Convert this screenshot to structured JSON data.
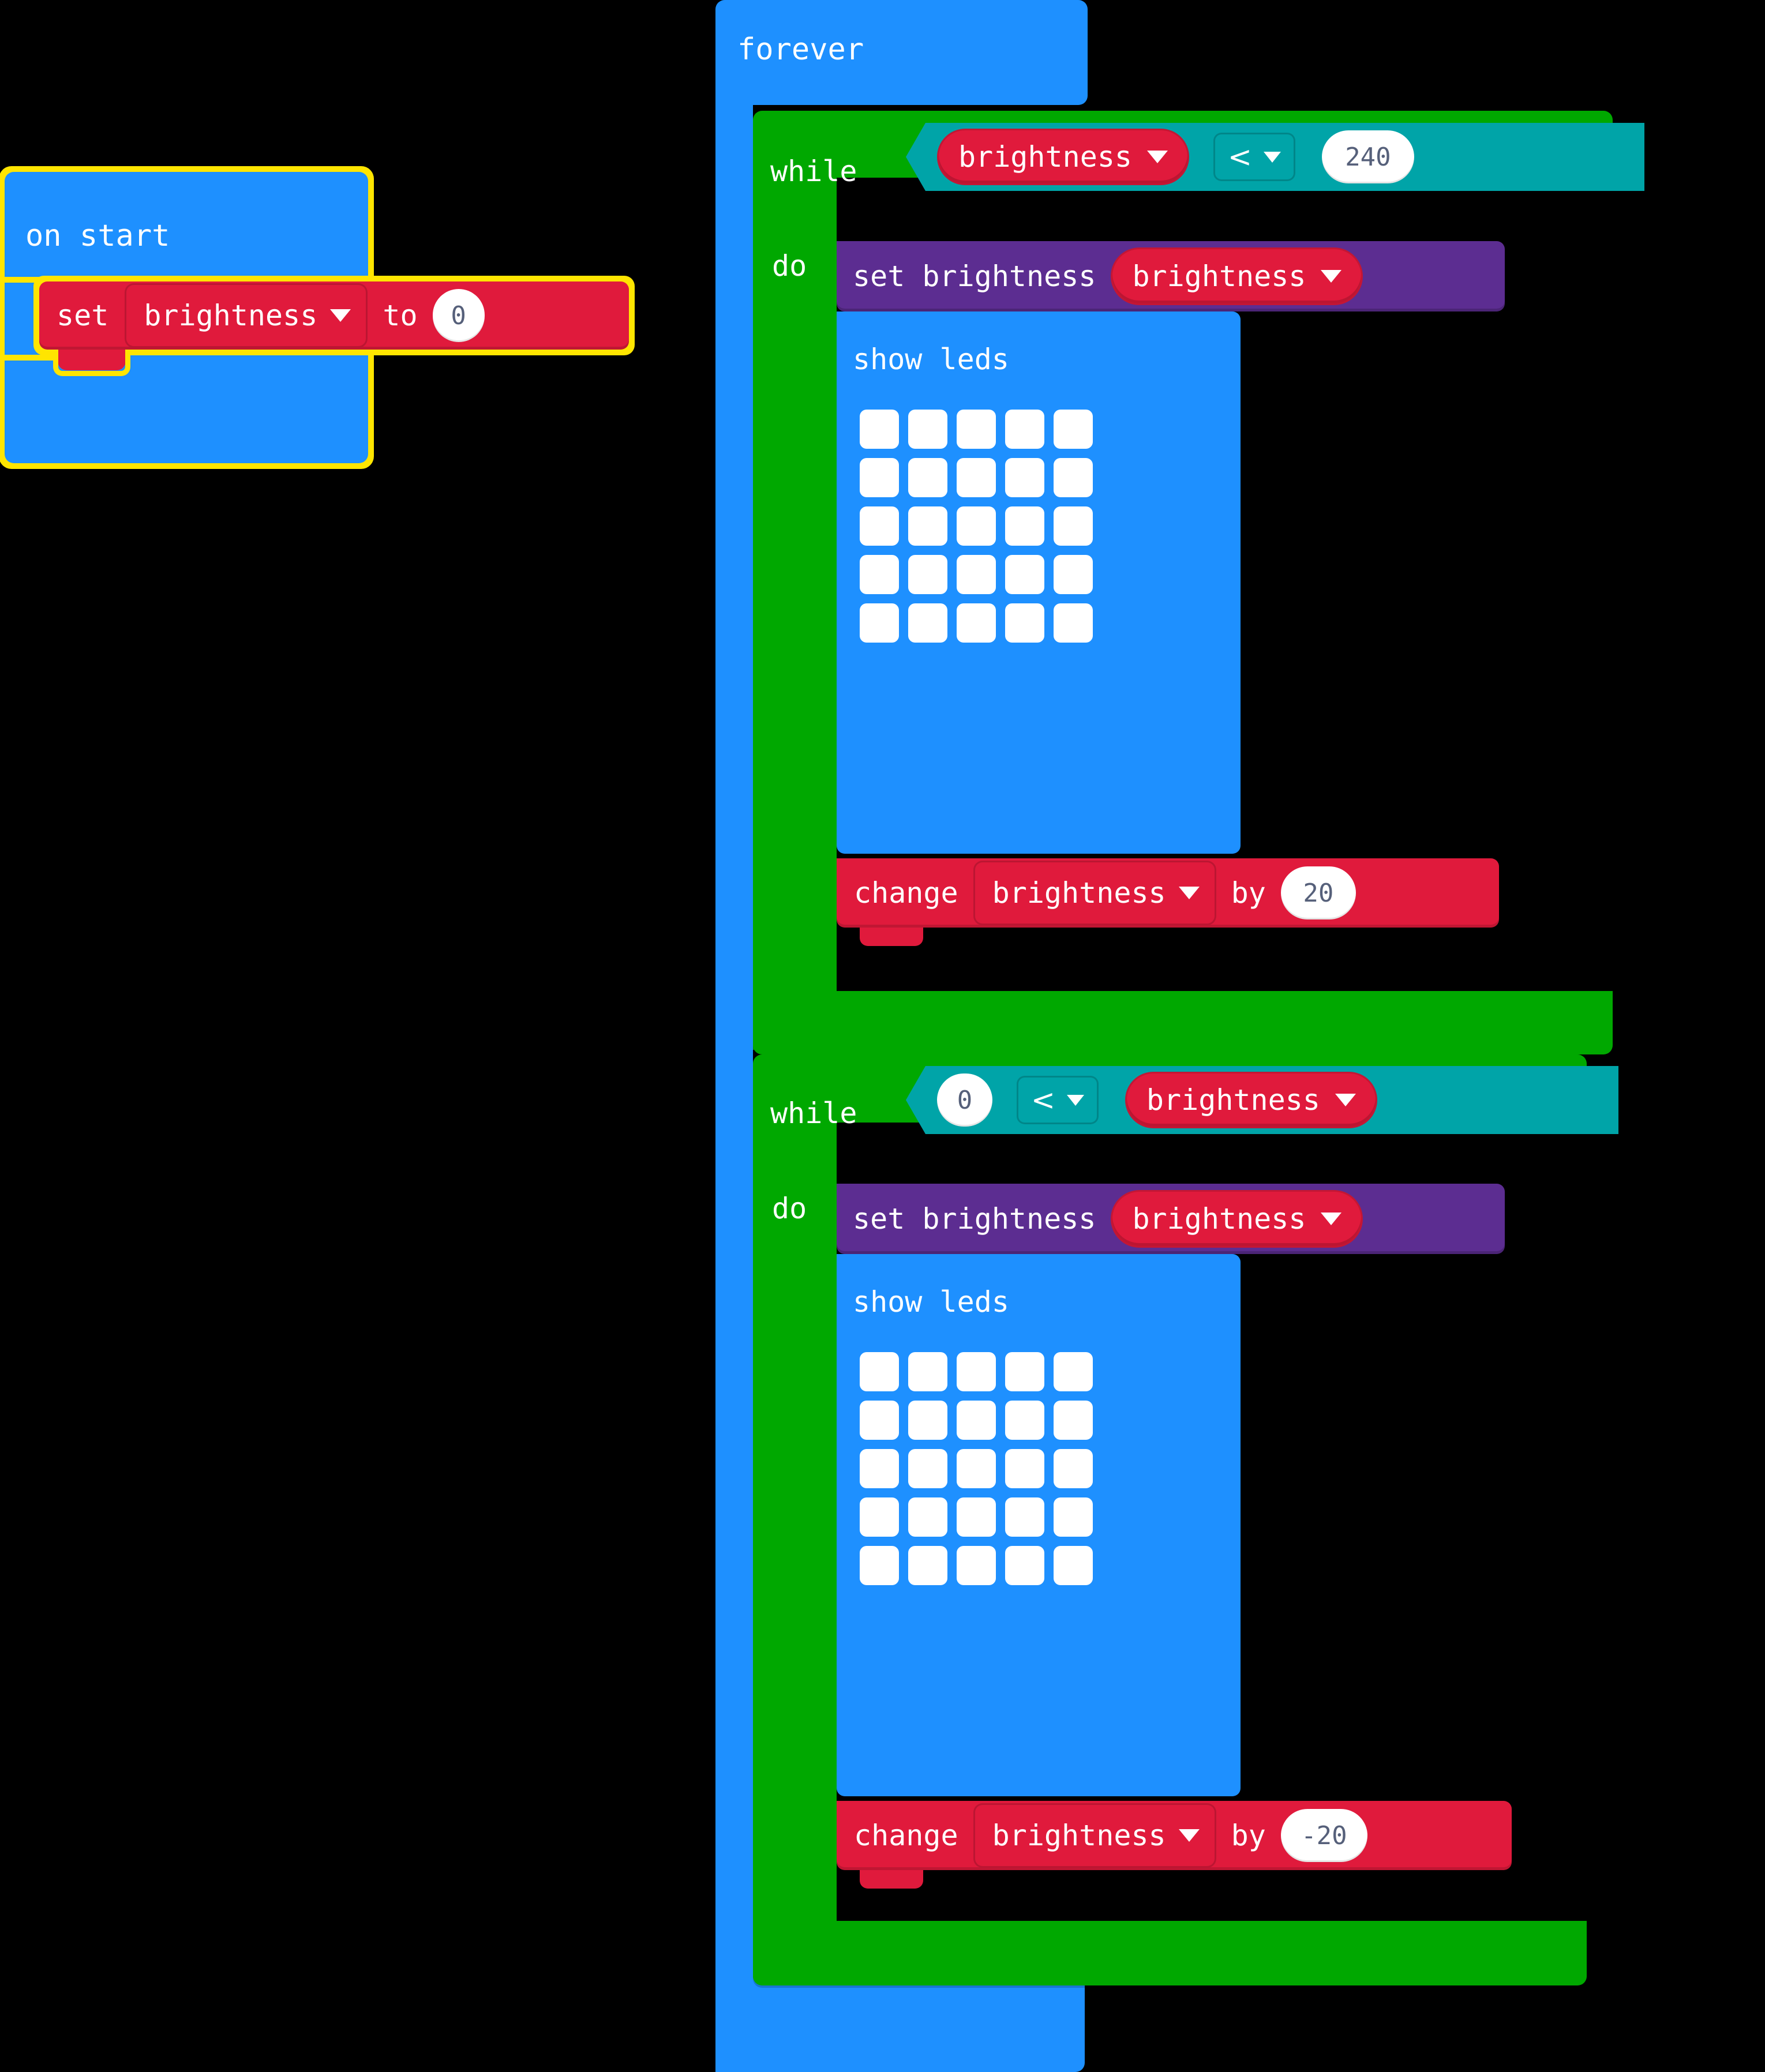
{
  "editor": {
    "background": "#000000",
    "palette": {
      "event_blue": "#1e90ff",
      "loop_green": "#00a800",
      "logic_teal": "#00a4a8",
      "variable_red": "#e01a3c",
      "led_purple": "#5c2d91",
      "selection_yellow": "#ffe500",
      "field_text_white": "#ffffff",
      "number_text": "#56607a"
    }
  },
  "scripts": [
    {
      "id": "on-start-script",
      "selected": true,
      "hat_label": "on start",
      "body": [
        {
          "kind": "set-variable",
          "prefix": "set",
          "variable": "brightness",
          "connector": "to",
          "value": "0"
        }
      ]
    },
    {
      "id": "forever-script",
      "selected": false,
      "hat_label": "forever",
      "body": [
        {
          "kind": "while-loop",
          "while_label": "while",
          "do_label": "do",
          "condition": {
            "left_kind": "variable",
            "left": "brightness",
            "operator": "<",
            "right_kind": "number",
            "right": "240"
          },
          "body": [
            {
              "kind": "set-led-brightness",
              "label": "set brightness",
              "argument_kind": "variable",
              "argument": "brightness"
            },
            {
              "kind": "show-leds",
              "label": "show leds",
              "grid": [
                [
                  1,
                  1,
                  1,
                  1,
                  1
                ],
                [
                  1,
                  1,
                  1,
                  1,
                  1
                ],
                [
                  1,
                  1,
                  1,
                  1,
                  1
                ],
                [
                  1,
                  1,
                  1,
                  1,
                  1
                ],
                [
                  1,
                  1,
                  1,
                  1,
                  1
                ]
              ]
            },
            {
              "kind": "change-variable",
              "prefix": "change",
              "variable": "brightness",
              "connector": "by",
              "value": "20"
            }
          ]
        },
        {
          "kind": "while-loop",
          "while_label": "while",
          "do_label": "do",
          "condition": {
            "left_kind": "number",
            "left": "0",
            "operator": "<",
            "right_kind": "variable",
            "right": "brightness"
          },
          "body": [
            {
              "kind": "set-led-brightness",
              "label": "set brightness",
              "argument_kind": "variable",
              "argument": "brightness"
            },
            {
              "kind": "show-leds",
              "label": "show leds",
              "grid": [
                [
                  1,
                  1,
                  1,
                  1,
                  1
                ],
                [
                  1,
                  1,
                  1,
                  1,
                  1
                ],
                [
                  1,
                  1,
                  1,
                  1,
                  1
                ],
                [
                  1,
                  1,
                  1,
                  1,
                  1
                ],
                [
                  1,
                  1,
                  1,
                  1,
                  1
                ]
              ]
            },
            {
              "kind": "change-variable",
              "prefix": "change",
              "variable": "brightness",
              "connector": "by",
              "value": "-20"
            }
          ]
        }
      ]
    }
  ],
  "icons": {
    "dropdown_caret": "chevron-down-icon",
    "less_than": "less-than-icon"
  }
}
